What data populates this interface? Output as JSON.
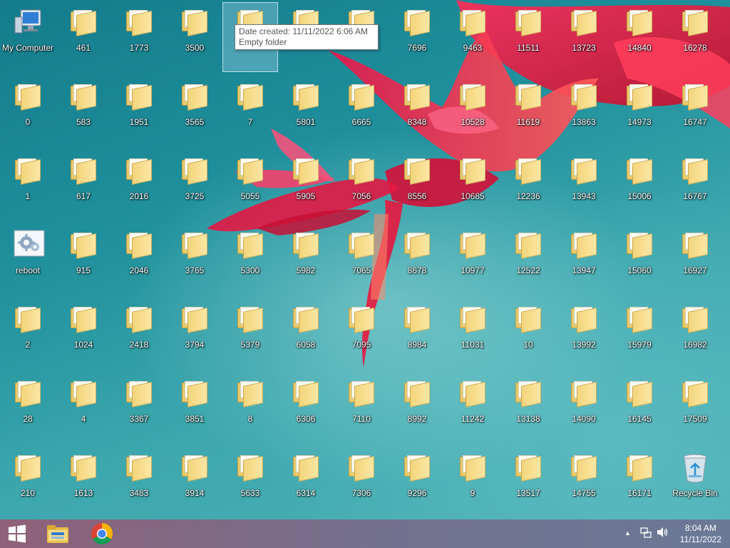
{
  "desktop": {
    "icons": [
      {
        "label": "My Computer",
        "type": "computer",
        "col": 0,
        "row": 0
      },
      {
        "label": "461",
        "type": "folder",
        "col": 1,
        "row": 0
      },
      {
        "label": "1773",
        "type": "folder",
        "col": 2,
        "row": 0
      },
      {
        "label": "3500",
        "type": "folder",
        "col": 3,
        "row": 0
      },
      {
        "label": "",
        "type": "folder",
        "col": 4,
        "row": 0,
        "selected": true
      },
      {
        "label": "",
        "type": "folder",
        "col": 5,
        "row": 0
      },
      {
        "label": "",
        "type": "folder",
        "col": 6,
        "row": 0
      },
      {
        "label": "7696",
        "type": "folder",
        "col": 7,
        "row": 0
      },
      {
        "label": "9463",
        "type": "folder",
        "col": 8,
        "row": 0
      },
      {
        "label": "11511",
        "type": "folder",
        "col": 9,
        "row": 0
      },
      {
        "label": "13723",
        "type": "folder",
        "col": 10,
        "row": 0
      },
      {
        "label": "14840",
        "type": "folder",
        "col": 11,
        "row": 0
      },
      {
        "label": "16278",
        "type": "folder",
        "col": 12,
        "row": 0
      },
      {
        "label": "0",
        "type": "folder",
        "col": 0,
        "row": 1
      },
      {
        "label": "583",
        "type": "folder",
        "col": 1,
        "row": 1
      },
      {
        "label": "1951",
        "type": "folder",
        "col": 2,
        "row": 1
      },
      {
        "label": "3565",
        "type": "folder",
        "col": 3,
        "row": 1
      },
      {
        "label": "7",
        "type": "folder",
        "col": 4,
        "row": 1
      },
      {
        "label": "5801",
        "type": "folder",
        "col": 5,
        "row": 1
      },
      {
        "label": "6665",
        "type": "folder",
        "col": 6,
        "row": 1
      },
      {
        "label": "8348",
        "type": "folder",
        "col": 7,
        "row": 1
      },
      {
        "label": "10528",
        "type": "folder",
        "col": 8,
        "row": 1
      },
      {
        "label": "11619",
        "type": "folder",
        "col": 9,
        "row": 1
      },
      {
        "label": "13863",
        "type": "folder",
        "col": 10,
        "row": 1
      },
      {
        "label": "14973",
        "type": "folder",
        "col": 11,
        "row": 1
      },
      {
        "label": "16747",
        "type": "folder",
        "col": 12,
        "row": 1
      },
      {
        "label": "1",
        "type": "folder",
        "col": 0,
        "row": 2
      },
      {
        "label": "617",
        "type": "folder",
        "col": 1,
        "row": 2
      },
      {
        "label": "2016",
        "type": "folder",
        "col": 2,
        "row": 2
      },
      {
        "label": "3725",
        "type": "folder",
        "col": 3,
        "row": 2
      },
      {
        "label": "5055",
        "type": "folder",
        "col": 4,
        "row": 2
      },
      {
        "label": "5905",
        "type": "folder",
        "col": 5,
        "row": 2
      },
      {
        "label": "7056",
        "type": "folder",
        "col": 6,
        "row": 2
      },
      {
        "label": "8556",
        "type": "folder",
        "col": 7,
        "row": 2
      },
      {
        "label": "10685",
        "type": "folder",
        "col": 8,
        "row": 2
      },
      {
        "label": "12236",
        "type": "folder",
        "col": 9,
        "row": 2
      },
      {
        "label": "13943",
        "type": "folder",
        "col": 10,
        "row": 2
      },
      {
        "label": "15006",
        "type": "folder",
        "col": 11,
        "row": 2
      },
      {
        "label": "16767",
        "type": "folder",
        "col": 12,
        "row": 2
      },
      {
        "label": "reboot",
        "type": "settings",
        "col": 0,
        "row": 3
      },
      {
        "label": "915",
        "type": "folder",
        "col": 1,
        "row": 3
      },
      {
        "label": "2046",
        "type": "folder",
        "col": 2,
        "row": 3
      },
      {
        "label": "3765",
        "type": "folder",
        "col": 3,
        "row": 3
      },
      {
        "label": "5300",
        "type": "folder",
        "col": 4,
        "row": 3
      },
      {
        "label": "5982",
        "type": "folder",
        "col": 5,
        "row": 3
      },
      {
        "label": "7065",
        "type": "folder",
        "col": 6,
        "row": 3
      },
      {
        "label": "8678",
        "type": "folder",
        "col": 7,
        "row": 3
      },
      {
        "label": "10977",
        "type": "folder",
        "col": 8,
        "row": 3
      },
      {
        "label": "12522",
        "type": "folder",
        "col": 9,
        "row": 3
      },
      {
        "label": "13947",
        "type": "folder",
        "col": 10,
        "row": 3
      },
      {
        "label": "15060",
        "type": "folder",
        "col": 11,
        "row": 3
      },
      {
        "label": "16927",
        "type": "folder",
        "col": 12,
        "row": 3
      },
      {
        "label": "2",
        "type": "folder",
        "col": 0,
        "row": 4
      },
      {
        "label": "1024",
        "type": "folder",
        "col": 1,
        "row": 4
      },
      {
        "label": "2418",
        "type": "folder",
        "col": 2,
        "row": 4
      },
      {
        "label": "3794",
        "type": "folder",
        "col": 3,
        "row": 4
      },
      {
        "label": "5379",
        "type": "folder",
        "col": 4,
        "row": 4
      },
      {
        "label": "6058",
        "type": "folder",
        "col": 5,
        "row": 4
      },
      {
        "label": "7095",
        "type": "folder",
        "col": 6,
        "row": 4
      },
      {
        "label": "8984",
        "type": "folder",
        "col": 7,
        "row": 4
      },
      {
        "label": "11031",
        "type": "folder",
        "col": 8,
        "row": 4
      },
      {
        "label": "10",
        "type": "folder",
        "col": 9,
        "row": 4
      },
      {
        "label": "13992",
        "type": "folder",
        "col": 10,
        "row": 4
      },
      {
        "label": "15979",
        "type": "folder",
        "col": 11,
        "row": 4
      },
      {
        "label": "16982",
        "type": "folder",
        "col": 12,
        "row": 4
      },
      {
        "label": "28",
        "type": "folder",
        "col": 0,
        "row": 5
      },
      {
        "label": "4",
        "type": "folder",
        "col": 1,
        "row": 5
      },
      {
        "label": "3367",
        "type": "folder",
        "col": 2,
        "row": 5
      },
      {
        "label": "3851",
        "type": "folder",
        "col": 3,
        "row": 5
      },
      {
        "label": "8",
        "type": "folder",
        "col": 4,
        "row": 5
      },
      {
        "label": "6306",
        "type": "folder",
        "col": 5,
        "row": 5
      },
      {
        "label": "7110",
        "type": "folder",
        "col": 6,
        "row": 5
      },
      {
        "label": "8992",
        "type": "folder",
        "col": 7,
        "row": 5
      },
      {
        "label": "11242",
        "type": "folder",
        "col": 8,
        "row": 5
      },
      {
        "label": "13138",
        "type": "folder",
        "col": 9,
        "row": 5
      },
      {
        "label": "14090",
        "type": "folder",
        "col": 10,
        "row": 5
      },
      {
        "label": "16145",
        "type": "folder",
        "col": 11,
        "row": 5
      },
      {
        "label": "17509",
        "type": "folder",
        "col": 12,
        "row": 5
      },
      {
        "label": "210",
        "type": "folder",
        "col": 0,
        "row": 6
      },
      {
        "label": "1613",
        "type": "folder",
        "col": 1,
        "row": 6
      },
      {
        "label": "3483",
        "type": "folder",
        "col": 2,
        "row": 6
      },
      {
        "label": "3914",
        "type": "folder",
        "col": 3,
        "row": 6
      },
      {
        "label": "5633",
        "type": "folder",
        "col": 4,
        "row": 6
      },
      {
        "label": "6314",
        "type": "folder",
        "col": 5,
        "row": 6
      },
      {
        "label": "7306",
        "type": "folder",
        "col": 6,
        "row": 6
      },
      {
        "label": "9296",
        "type": "folder",
        "col": 7,
        "row": 6
      },
      {
        "label": "9",
        "type": "folder",
        "col": 8,
        "row": 6
      },
      {
        "label": "13517",
        "type": "folder",
        "col": 9,
        "row": 6
      },
      {
        "label": "14755",
        "type": "folder",
        "col": 10,
        "row": 6
      },
      {
        "label": "16171",
        "type": "folder",
        "col": 11,
        "row": 6
      },
      {
        "label": "Recycle Bin",
        "type": "recycle",
        "col": 12,
        "row": 6
      }
    ]
  },
  "tooltip": {
    "line1": "Date created: 11/11/2022 6:06 AM",
    "line2": "Empty folder"
  },
  "taskbar": {
    "start_icon": "windows-start-icon",
    "pinned": [
      {
        "name": "file-explorer-icon"
      },
      {
        "name": "chrome-icon"
      }
    ],
    "tray": {
      "show_hidden_icon": "▲",
      "network_icon": "network-icon",
      "volume_icon": "volume-icon"
    },
    "clock": {
      "time": "8:04 AM",
      "date": "11/11/2022"
    }
  },
  "colors": {
    "folder": "#f3d47a",
    "taskbar": "#8a6a86",
    "selection": "#aad7eb"
  }
}
